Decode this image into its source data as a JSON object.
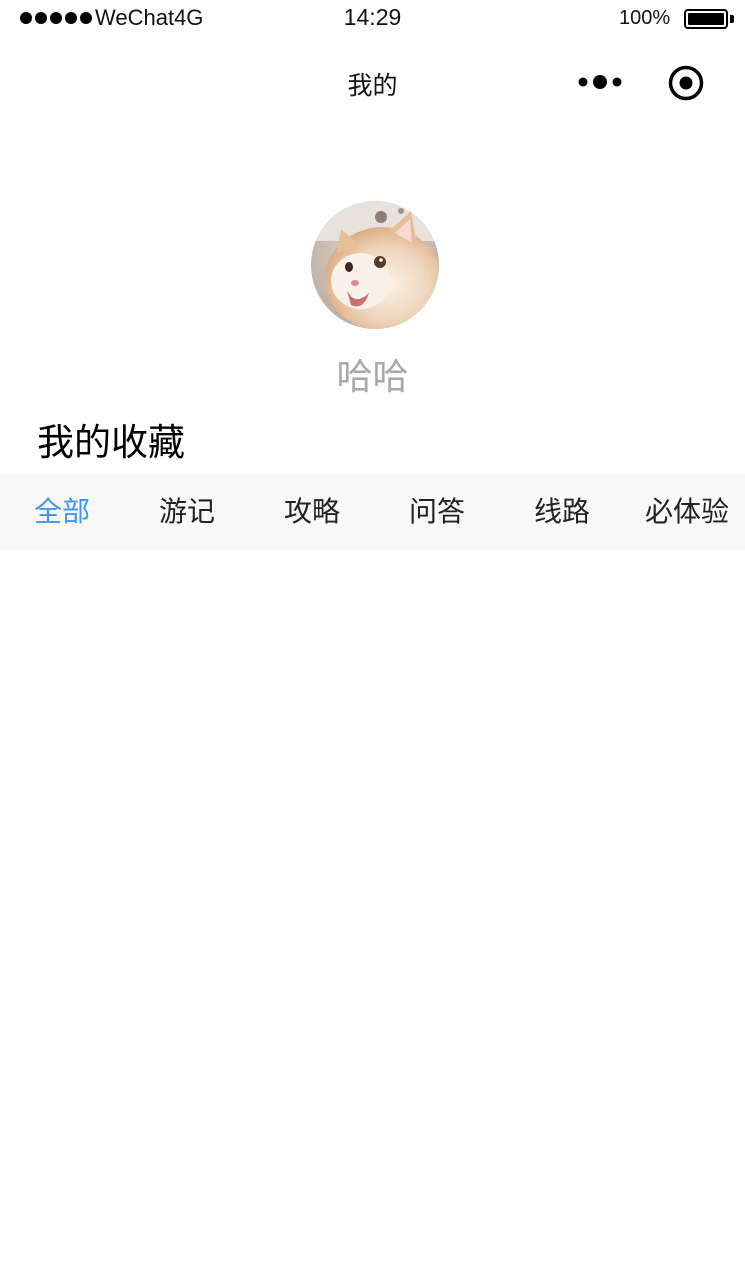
{
  "status_bar": {
    "carrier": "WeChat4G",
    "time": "14:29",
    "battery_percent": "100%",
    "battery_level": 1.0,
    "signal_bars": 5
  },
  "nav": {
    "title": "我的",
    "more_icon": "more-dots-icon",
    "capsule_icon": "target-circle-icon"
  },
  "profile": {
    "avatar": "cat-photo",
    "name": "哈哈"
  },
  "favorites": {
    "title": "我的收藏",
    "active_tab": "全部",
    "active_color": "#3d97f1",
    "tabs": [
      {
        "label": "全部"
      },
      {
        "label": "游记"
      },
      {
        "label": "攻略"
      },
      {
        "label": "问答"
      },
      {
        "label": "线路"
      },
      {
        "label": "必体验"
      }
    ]
  }
}
